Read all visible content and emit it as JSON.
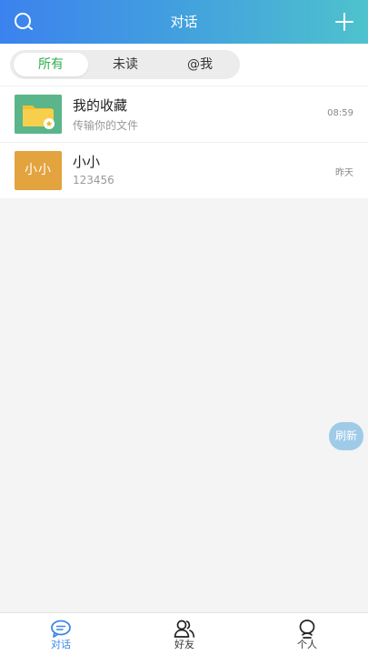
{
  "header": {
    "title": "对话"
  },
  "tabs": [
    {
      "label": "所有",
      "selected": true
    },
    {
      "label": "未读",
      "selected": false
    },
    {
      "label": "@我",
      "selected": false
    }
  ],
  "conversations": [
    {
      "name": "我的收藏",
      "subtitle": "传输你的文件",
      "time": "08:59",
      "avatar": "folder-star-icon"
    },
    {
      "name": "小小",
      "subtitle": "123456",
      "time": "昨天",
      "avatar_text": "小小"
    }
  ],
  "refresh_label": "刷新",
  "bottom_nav": [
    {
      "label": "对话",
      "icon": "chat-icon",
      "active": true
    },
    {
      "label": "好友",
      "icon": "friends-icon",
      "active": false
    },
    {
      "label": "个人",
      "icon": "person-icon",
      "active": false
    }
  ],
  "colors": {
    "header_gradient_start": "#3b82ee",
    "header_gradient_end": "#4ec2cd",
    "tab_active": "#2fae4f",
    "nav_active": "#3a86e8",
    "avatar_folder_bg": "#5bb58a",
    "avatar_text_bg": "#e3a33f"
  }
}
